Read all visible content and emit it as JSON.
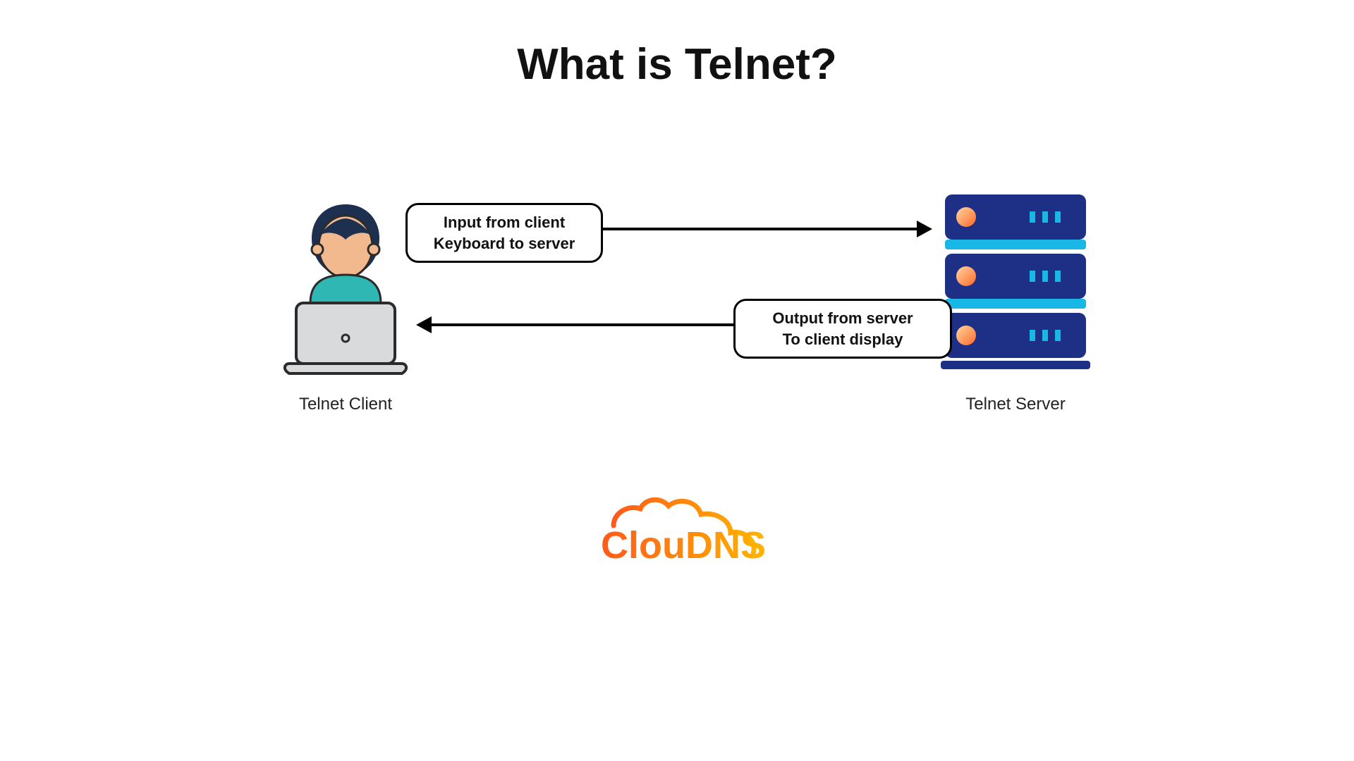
{
  "title": "What is Telnet?",
  "client": {
    "label": "Telnet Client"
  },
  "server": {
    "label": "Telnet Server"
  },
  "arrows": {
    "input": {
      "line1": "Input from client",
      "line2": "Keyboard to server"
    },
    "output": {
      "line1": "Output from server",
      "line2": "To client display"
    }
  },
  "logo": {
    "text": "ClouDNS"
  },
  "colors": {
    "server_dark": "#1e2f86",
    "server_light": "#18b7e6",
    "server_led": "#ff7a3c",
    "laptop_body": "#d8dadc",
    "laptop_stroke": "#2b2b2b",
    "person_skin": "#f2b98f",
    "person_hair": "#1e3050",
    "person_shirt": "#2fb7b3",
    "logo_orange": "#ff7a1a",
    "logo_yellow": "#ffb400"
  }
}
